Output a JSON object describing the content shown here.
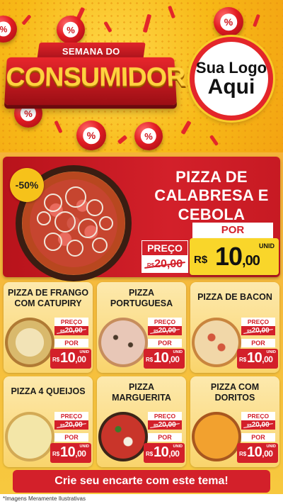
{
  "header": {
    "banner_top": "SEMANA DO",
    "banner_main": "CONSUMIDOR",
    "logo_line1": "Sua Logo",
    "logo_line2": "Aqui",
    "ball_symbol": "%"
  },
  "featured": {
    "discount_badge": "-50%",
    "title_lines": [
      "PIZZA DE",
      "CALABRESA E",
      "CEBOLA"
    ],
    "preco_label": "PREÇO",
    "old_currency": "R$",
    "old_price": "20,00",
    "por_label": "POR",
    "currency": "R$",
    "price_int": "10",
    "price_dec": ",00",
    "unid": "UNID"
  },
  "cards": [
    {
      "title1": "PIZZA DE FRANGO",
      "title2": "COM CATUPIRY",
      "preco_label": "PREÇO",
      "old_currency": "R$",
      "old_price": "20,00",
      "por_label": "POR",
      "currency": "R$",
      "price_int": "10",
      "price_dec": ",00",
      "unid": "UNID"
    },
    {
      "title1": "PIZZA",
      "title2": "PORTUGUESA",
      "preco_label": "PREÇO",
      "old_currency": "R$",
      "old_price": "20,00",
      "por_label": "POR",
      "currency": "R$",
      "price_int": "10",
      "price_dec": ",00",
      "unid": "UNID"
    },
    {
      "title1": "PIZZA DE BACON",
      "title2": "",
      "preco_label": "PREÇO",
      "old_currency": "R$",
      "old_price": "20,00",
      "por_label": "POR",
      "currency": "R$",
      "price_int": "10",
      "price_dec": ",00",
      "unid": "UNID"
    },
    {
      "title1": "PIZZA 4 QUEIJOS",
      "title2": "",
      "preco_label": "PREÇO",
      "old_currency": "R$",
      "old_price": "20,00",
      "por_label": "POR",
      "currency": "R$",
      "price_int": "10",
      "price_dec": ",00",
      "unid": "UNID"
    },
    {
      "title1": "PIZZA",
      "title2": "MARGUERITA",
      "preco_label": "PREÇO",
      "old_currency": "R$",
      "old_price": "20,00",
      "por_label": "POR",
      "currency": "R$",
      "price_int": "10",
      "price_dec": ",00",
      "unid": "UNID"
    },
    {
      "title1": "PIZZA COM",
      "title2": "DORITOS",
      "preco_label": "PREÇO",
      "old_currency": "R$",
      "old_price": "20,00",
      "por_label": "POR",
      "currency": "R$",
      "price_int": "10",
      "price_dec": ",00",
      "unid": "UNID"
    }
  ],
  "cta": "Crie seu encarte com este tema!",
  "footnote": "*Imagens Meramente Ilustrativas",
  "colors": {
    "red": "#d3202a",
    "yellow": "#f9d62a",
    "cream": "#fde9ad"
  }
}
